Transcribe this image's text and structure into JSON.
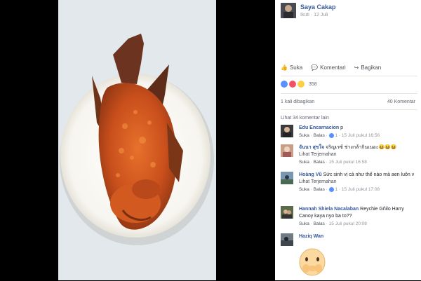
{
  "post": {
    "author": "Saya Cakap",
    "meta_follow": "Ikuti",
    "meta_date": "12 Juli"
  },
  "actions": {
    "like": "Suka",
    "comment": "Komentari",
    "share": "Bagikan"
  },
  "stats": {
    "reaction_count": "358",
    "shares": "1 kali dibagikan",
    "comments": "40 Komentar",
    "view_more": "Lihat 34 komentar lain"
  },
  "colors": {
    "link": "#365899",
    "like": "#5890ff",
    "love": "#f25268",
    "haha": "#fcd046"
  },
  "comments": [
    {
      "name": "Edu Encarnacion",
      "text": "p",
      "translate": "",
      "like": "Suka",
      "reply": "Balas",
      "reactions": "1",
      "time": "15 Juli pukul 16:56"
    },
    {
      "name": "จันนา สุขใจ",
      "text": "จริญเรซ์ ช่างกล้ากินเนอะ😆😆😆",
      "translate": "Lihat Terjemahan",
      "like": "Suka",
      "reply": "Balas",
      "reactions": "",
      "time": "15 Juli pukul 16:58"
    },
    {
      "name": "Hoàng Vũ",
      "text": "Sức sinh vị cả như thể nào mà aen luôn v",
      "translate": "Lihat Terjemahan",
      "like": "Suka",
      "reply": "Balas",
      "reactions": "1",
      "time": "15 Juli pukul 17:08"
    },
    {
      "name": "Hannah Shiela Nacalaban",
      "text": "Reychie Gñilo Harry Canoy kaya nyo ba to??",
      "translate": "",
      "like": "Suka",
      "reply": "Balas",
      "reactions": "",
      "time": "15 Juli pukul 20:08"
    },
    {
      "name": "Haziq Wan",
      "text": "",
      "translate": "",
      "like": "",
      "reply": "",
      "reactions": "",
      "time": ""
    }
  ]
}
